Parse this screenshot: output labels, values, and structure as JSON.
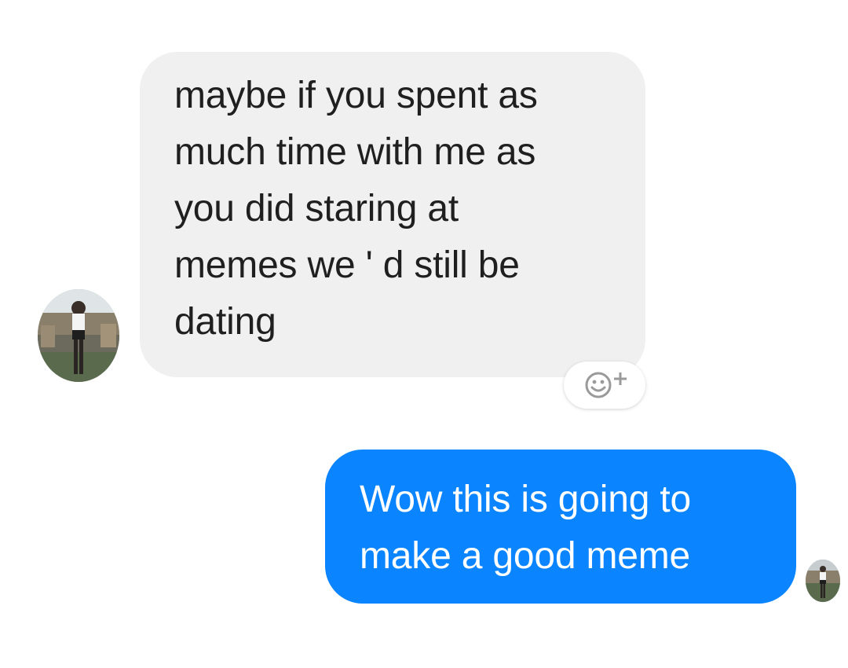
{
  "conversation": {
    "messages": [
      {
        "direction": "received",
        "lines": [
          "maybe if you spent as",
          "much time with me as",
          "you did staring at",
          "memes we ' d still be",
          "dating"
        ]
      },
      {
        "direction": "sent",
        "lines": [
          "Wow this is going to",
          "make a good meme"
        ]
      }
    ]
  },
  "icons": {
    "reaction": "add-reaction-icon",
    "avatar_left": "contact-avatar",
    "avatar_right": "self-avatar"
  },
  "colors": {
    "received_bubble": "#f1f0f0",
    "sent_bubble": "#0a84ff",
    "received_text": "#1f1f1f",
    "sent_text": "#ffffff"
  }
}
